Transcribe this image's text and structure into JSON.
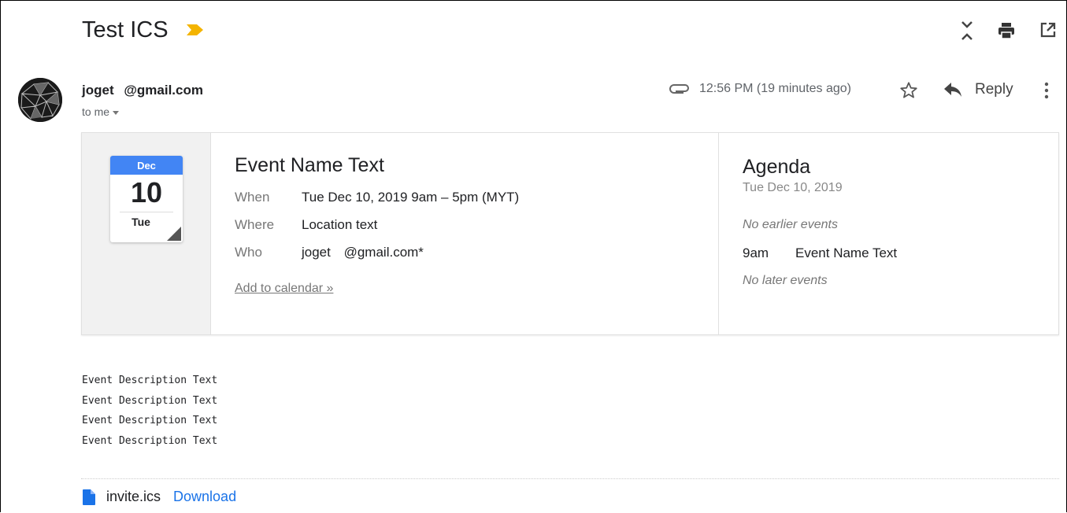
{
  "email": {
    "subject": "Test ICS",
    "label_color": "#f4b400",
    "sender": "joget @gmail.com",
    "to": "to me",
    "timestamp": "12:56 PM (19 minutes ago)",
    "reply_label": "Reply",
    "icons": {
      "expand": "collapse-expand-icon",
      "print": "print-icon",
      "popout": "open-in-new-window-icon",
      "attachment": "paperclip-icon",
      "star": "star-icon",
      "reply": "reply-arrow-icon",
      "more": "more-vert-icon"
    }
  },
  "invite": {
    "calendar_icon": {
      "month": "Dec",
      "day": "10",
      "weekday": "Tue",
      "accent": "#4285f4"
    },
    "event_name": "Event Name Text",
    "details": [
      {
        "label": "When",
        "value": "Tue Dec 10, 2019 9am – 5pm (MYT)"
      },
      {
        "label": "Where",
        "value": "Location text"
      },
      {
        "label": "Who",
        "value": "joget @gmail.com*"
      }
    ],
    "add_to_calendar": "Add to calendar »"
  },
  "agenda": {
    "title": "Agenda",
    "date": "Tue Dec 10, 2019",
    "earlier": "No earlier events",
    "event_time": "9am",
    "event_name": "Event Name Text",
    "later": "No later events"
  },
  "body": {
    "lines": [
      "Event Description Text",
      "Event Description Text",
      "Event Description Text",
      "Event Description Text"
    ]
  },
  "attachment": {
    "filename": "invite.ics",
    "download_label": "Download",
    "icon_color": "#1a73e8"
  }
}
